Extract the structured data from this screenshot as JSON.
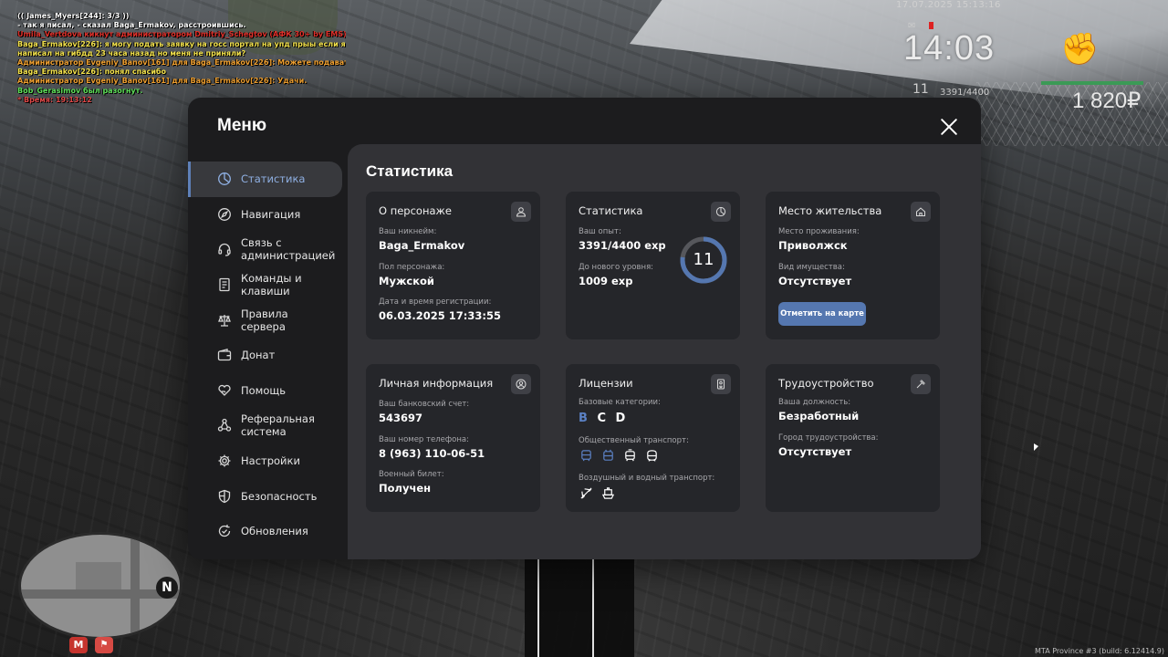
{
  "chat": [
    {
      "text": "(( James_Myers[244]: 3/3 ))",
      "color": "#ffffff"
    },
    {
      "text": "- так я писал, - сказал Baga_Ermakov, расстроившись.",
      "color": "#ffffff"
    },
    {
      "text": "Umila_Vertdova кикнут администратором Dmitriy_Schegtov (АФК 30+ by EMS)",
      "color": "#e0302a"
    },
    {
      "text": "Baga_Ermakov[226]: я могу подать заявку на госс портал на упд прыы если я",
      "color": "#f3e24c"
    },
    {
      "text": "написал на гибдд 23 часа назад но меня не приняли?",
      "color": "#f3e24c"
    },
    {
      "text": "Администратор Evgeniy_Banov[161] для Baga_Ermakov[226]: Можете подавать.",
      "color": "#f0a030"
    },
    {
      "text": "Baga_Ermakov[226]: понял спасибо",
      "color": "#f3e24c"
    },
    {
      "text": "Администратор Evgeniy_Banov[161] для Baga_Ermakov[226]: Удачи.",
      "color": "#f0a030"
    },
    {
      "text": "Bob_Gerasimov был разогнут.",
      "color": "#5fe05a"
    },
    {
      "text": "* Время: 19:13:12",
      "color": "#e04848"
    }
  ],
  "hud": {
    "date": "17.07.2025 15:13:16",
    "time": "14:03",
    "level": "11",
    "exp": "3391/4400",
    "money": "1 820₽"
  },
  "build": "MTA Province #3 (build: 6.12414.9)",
  "minimap": {
    "north": "N",
    "metro": "M"
  },
  "menu": {
    "title": "Меню",
    "sidebar": [
      {
        "label": "Статистика",
        "icon": "chart-pie-icon",
        "active": true
      },
      {
        "label": "Навигация",
        "icon": "compass-icon"
      },
      {
        "label": "Связь с администрацией",
        "icon": "headset-icon"
      },
      {
        "label": "Команды и клавиши",
        "icon": "document-icon"
      },
      {
        "label": "Правила сервера",
        "icon": "scales-icon"
      },
      {
        "label": "Донат",
        "icon": "wallet-icon"
      },
      {
        "label": "Помощь",
        "icon": "heart-hand-icon"
      },
      {
        "label": "Реферальная система",
        "icon": "network-icon"
      },
      {
        "label": "Настройки",
        "icon": "gear-icon"
      },
      {
        "label": "Безопасность",
        "icon": "shield-icon"
      },
      {
        "label": "Обновления",
        "icon": "refresh-check-icon"
      }
    ],
    "content_title": "Статистика",
    "cards": {
      "character": {
        "title": "О персонаже",
        "nickname_label": "Ваш никнейм:",
        "nickname": "Baga_Ermakov",
        "gender_label": "Пол персонажа:",
        "gender": "Мужской",
        "reg_label": "Дата и время регистрации:",
        "reg": "06.03.2025 17:33:55"
      },
      "stats": {
        "title": "Статистика",
        "exp_label": "Ваш опыт:",
        "exp": "3391/4400 exp",
        "next_label": "До нового уровня:",
        "next": "1009 exp",
        "level": "11",
        "progress": 0.77
      },
      "residence": {
        "title": "Место жительства",
        "place_label": "Место проживания:",
        "place": "Приволжск",
        "property_label": "Вид имущества:",
        "property": "Отсутствует",
        "map_button": "Отметить на карте"
      },
      "personal": {
        "title": "Личная информация",
        "bank_label": "Ваш банковский счет:",
        "bank": "543697",
        "phone_label": "Ваш номер телефона:",
        "phone": "8 (963) 110-06-51",
        "military_label": "Военный билет:",
        "military": "Получен"
      },
      "licenses": {
        "title": "Лицензии",
        "base_label": "Базовые категории:",
        "categories": [
          "B",
          "C",
          "D"
        ],
        "public_label": "Общественный транспорт:",
        "public_icons": [
          "bus-icon",
          "trolleybus-icon",
          "tram-icon",
          "metro-icon"
        ],
        "air_label": "Воздушный и водный транспорт:",
        "air_icons": [
          "plane-icon",
          "boat-icon"
        ]
      },
      "employment": {
        "title": "Трудоустройство",
        "position_label": "Ваша должность:",
        "position": "Безработный",
        "city_label": "Город трудоустройства:",
        "city": "Отсутствует"
      }
    }
  }
}
